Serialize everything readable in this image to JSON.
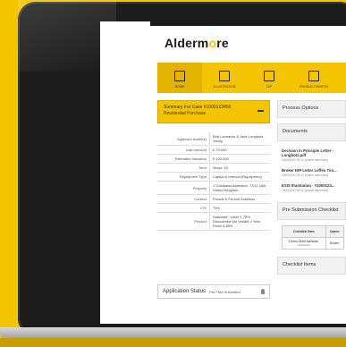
{
  "app": {
    "logo_text_a": "Alderm",
    "logo_text_b": "o",
    "logo_text_c": "re"
  },
  "nav": {
    "items": [
      {
        "label": "HOME",
        "icon": "home-icon",
        "active": true
      },
      {
        "label": "ILLUSTRATION",
        "icon": "document-plus-icon",
        "active": false
      },
      {
        "label": "DIP",
        "icon": "house-check-icon",
        "active": false
      },
      {
        "label": "PRODUCT SWITCH",
        "icon": "door-icon",
        "active": false
      }
    ]
  },
  "summary": {
    "header_line1": "Summary For Case #1000123456",
    "header_line2": "Residential Purchase"
  },
  "details": [
    {
      "key": "Applicant Name(s)",
      "value": "Bob Leonardo & Jade Longbotz, Yancy"
    },
    {
      "key": "Loan amount",
      "value": "£ 79,000"
    },
    {
      "key": "Estimated Valuation",
      "value": "£ 100,000"
    },
    {
      "key": "Term",
      "value": "Years: 15"
    },
    {
      "key": "Repayment Type",
      "value": "Capital & Interest (Repayment)"
    },
    {
      "key": "Property",
      "value": "1 Goldhaws Alderston, TS11 1AB United Kingdom"
    },
    {
      "key": "Context",
      "value": "Pursuit & Pursuit Solicitors"
    },
    {
      "key": "LTV",
      "value": "79%"
    },
    {
      "key": "Product",
      "value": "Standard - Level 1 75% Discounted Var Variant 2 Year Fixed 3.48%"
    }
  ],
  "status": {
    "label": "Application Status",
    "value": "Pre FMA Submitted"
  },
  "right": {
    "process_options": "Process Options",
    "documents": "Documents",
    "docs": [
      {
        "title": "Decision In Principle Letter - Longbotz.pdf",
        "meta": "15/09/2020 09:12 [Jesper aldermore]"
      },
      {
        "title": "Broker DIP Letter Leffen Tim...",
        "meta": "15/09/2020 09:12 [Jesper aldermore]"
      },
      {
        "title": "ESIS Illustration - #1000123...",
        "meta": "15/09/2020 09:12 [Jesper aldermore]"
      }
    ],
    "checklist_title": "Pre Submission Checklist",
    "checklist_headers": [
      "Checklist Item",
      "Owner"
    ],
    "checklist_rows": [
      {
        "item": "Direct Debit Mandate",
        "meta": "15/09/2020",
        "owner": "Broker"
      }
    ],
    "checklist_items": "Checklist Items"
  }
}
